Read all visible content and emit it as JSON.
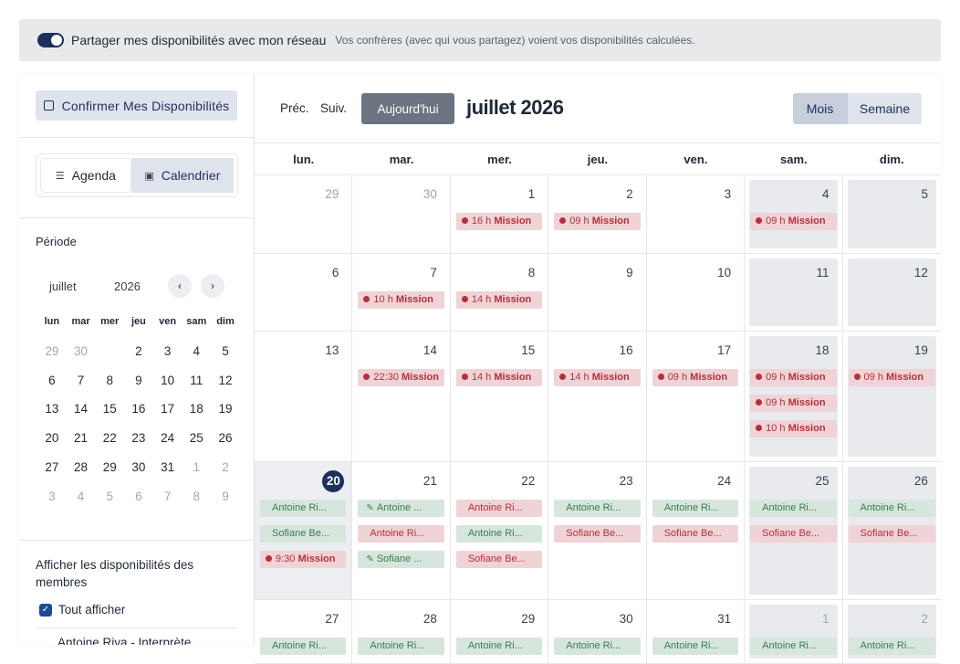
{
  "share": {
    "label": "Partager mes disponibilités avec mon réseau",
    "description": "Vos confrères (avec qui vous partagez) voient vos disponibilités calculées."
  },
  "sidebar": {
    "confirm_label": "Confirmer Mes Disponibilités",
    "tabs": {
      "agenda": "Agenda",
      "calendar": "Calendrier"
    },
    "period_title": "Période",
    "mini": {
      "month": "juillet",
      "year": "2026",
      "weekdays": [
        "lun",
        "mar",
        "mer",
        "jeu",
        "ven",
        "sam",
        "dim"
      ],
      "weeks": [
        [
          "29",
          "30",
          "1",
          "2",
          "3",
          "4",
          "5"
        ],
        [
          "6",
          "7",
          "8",
          "9",
          "10",
          "11",
          "12"
        ],
        [
          "13",
          "14",
          "15",
          "16",
          "17",
          "18",
          "19"
        ],
        [
          "20",
          "21",
          "22",
          "23",
          "24",
          "25",
          "26"
        ],
        [
          "27",
          "28",
          "29",
          "30",
          "31",
          "1",
          "2"
        ],
        [
          "3",
          "4",
          "5",
          "6",
          "7",
          "8",
          "9"
        ]
      ]
    },
    "members_title": "Afficher les disponibilités des membres",
    "show_all": "Tout afficher",
    "member_1": "Antoine Riva - Interprète"
  },
  "calendar": {
    "prev": "Préc.",
    "next": "Suiv.",
    "today": "Aujourd'hui",
    "title": "juillet 2026",
    "view_month": "Mois",
    "view_week": "Semaine",
    "dow": [
      "lun.",
      "mar.",
      "mer.",
      "jeu.",
      "ven.",
      "sam.",
      "dim."
    ],
    "weeks": [
      [
        {
          "n": "29",
          "out": true,
          "ev": []
        },
        {
          "n": "30",
          "out": true,
          "ev": []
        },
        {
          "n": "1",
          "ev": [
            {
              "t": "red",
              "h": "16 h",
              "s": "Mission"
            }
          ]
        },
        {
          "n": "2",
          "ev": [
            {
              "t": "red",
              "h": "09 h",
              "s": "Mission"
            }
          ]
        },
        {
          "n": "3",
          "ev": []
        },
        {
          "n": "4",
          "we": true,
          "ev": [
            {
              "t": "red",
              "h": "09 h",
              "s": "Mission"
            }
          ]
        },
        {
          "n": "5",
          "we": true,
          "ev": []
        }
      ],
      [
        {
          "n": "6",
          "ev": []
        },
        {
          "n": "7",
          "ev": [
            {
              "t": "red",
              "h": "10 h",
              "s": "Mission"
            }
          ]
        },
        {
          "n": "8",
          "ev": [
            {
              "t": "red",
              "h": "14 h",
              "s": "Mission"
            }
          ]
        },
        {
          "n": "9",
          "ev": []
        },
        {
          "n": "10",
          "ev": []
        },
        {
          "n": "11",
          "we": true,
          "ev": []
        },
        {
          "n": "12",
          "we": true,
          "ev": []
        }
      ],
      [
        {
          "n": "13",
          "ev": []
        },
        {
          "n": "14",
          "ev": [
            {
              "t": "red",
              "h": "22:30",
              "s": "Mission"
            }
          ]
        },
        {
          "n": "15",
          "ev": [
            {
              "t": "red",
              "h": "14 h",
              "s": "Mission"
            }
          ]
        },
        {
          "n": "16",
          "ev": [
            {
              "t": "red",
              "h": "14 h",
              "s": "Mission"
            }
          ]
        },
        {
          "n": "17",
          "ev": [
            {
              "t": "red",
              "h": "09 h",
              "s": "Mission"
            }
          ]
        },
        {
          "n": "18",
          "we": true,
          "ev": [
            {
              "t": "red",
              "h": "09 h",
              "s": "Mission"
            },
            {
              "t": "red",
              "h": "09 h",
              "s": "Mission"
            },
            {
              "t": "red",
              "h": "10 h",
              "s": "Mission"
            }
          ]
        },
        {
          "n": "19",
          "we": true,
          "ev": [
            {
              "t": "red",
              "h": "09 h",
              "s": "Mission"
            }
          ]
        }
      ],
      [
        {
          "n": "20",
          "today": true,
          "ev": [
            {
              "t": "green",
              "s": "Antoine Ri..."
            },
            {
              "t": "green",
              "s": "Sofiane Be..."
            },
            {
              "t": "red",
              "h": "9:30",
              "s": "Mission"
            }
          ]
        },
        {
          "n": "21",
          "ev": [
            {
              "t": "green",
              "ed": true,
              "s": "Antoine ..."
            },
            {
              "t": "pink",
              "s": "Antoine Ri..."
            },
            {
              "t": "green",
              "ed": true,
              "s": "Sofiane ..."
            }
          ]
        },
        {
          "n": "22",
          "ev": [
            {
              "t": "pink",
              "s": "Antoine Ri..."
            },
            {
              "t": "green",
              "s": "Antoine Ri..."
            },
            {
              "t": "pink",
              "s": "Sofiane Be..."
            }
          ]
        },
        {
          "n": "23",
          "ev": [
            {
              "t": "green",
              "s": "Antoine Ri..."
            },
            {
              "t": "pink",
              "s": "Sofiane Be..."
            }
          ]
        },
        {
          "n": "24",
          "ev": [
            {
              "t": "green",
              "s": "Antoine Ri..."
            },
            {
              "t": "pink",
              "s": "Sofiane Be..."
            }
          ]
        },
        {
          "n": "25",
          "we": true,
          "ev": [
            {
              "t": "green",
              "s": "Antoine Ri..."
            },
            {
              "t": "pink",
              "s": "Sofiane Be..."
            }
          ]
        },
        {
          "n": "26",
          "we": true,
          "ev": [
            {
              "t": "green",
              "s": "Antoine Ri..."
            },
            {
              "t": "pink",
              "s": "Sofiane Be..."
            }
          ]
        }
      ],
      [
        {
          "n": "27",
          "ev": [
            {
              "t": "green",
              "s": "Antoine Ri..."
            }
          ]
        },
        {
          "n": "28",
          "ev": [
            {
              "t": "green",
              "s": "Antoine Ri..."
            }
          ]
        },
        {
          "n": "29",
          "ev": [
            {
              "t": "green",
              "s": "Antoine Ri..."
            }
          ]
        },
        {
          "n": "30",
          "ev": [
            {
              "t": "green",
              "s": "Antoine Ri..."
            }
          ]
        },
        {
          "n": "31",
          "ev": [
            {
              "t": "green",
              "s": "Antoine Ri..."
            }
          ]
        },
        {
          "n": "1",
          "out": true,
          "we": true,
          "ev": [
            {
              "t": "green",
              "s": "Antoine Ri..."
            }
          ]
        },
        {
          "n": "2",
          "out": true,
          "we": true,
          "ev": [
            {
              "t": "green",
              "s": "Antoine Ri..."
            }
          ]
        }
      ]
    ]
  }
}
